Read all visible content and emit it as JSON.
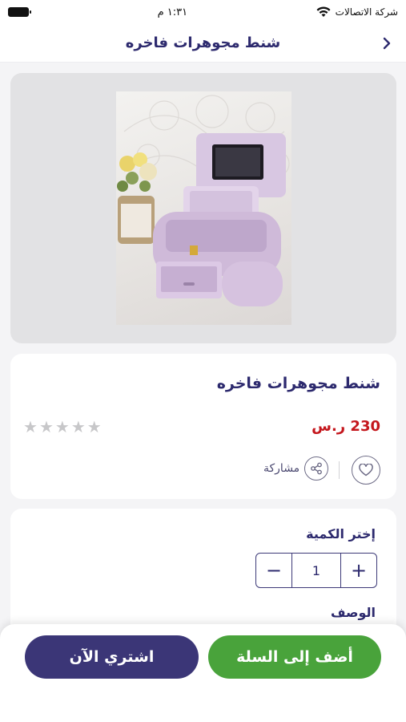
{
  "status_bar": {
    "carrier": "شركة الاتصالات",
    "time": "١:٣١ م"
  },
  "nav": {
    "title": "شنط مجوهرات فاخره",
    "back_icon": "chevron-right-icon"
  },
  "product": {
    "image_alt": "jewelry box photo",
    "title": "شنط مجوهرات فاخره",
    "price": "230 ر.س",
    "rating": 0,
    "rating_max": 5,
    "share_label": "مشاركة",
    "favorite_icon": "heart-icon",
    "share_icon": "share-icon"
  },
  "quantity": {
    "label": "إختر الكمية",
    "value": "1",
    "minus": "−",
    "plus": "+"
  },
  "description": {
    "label": "الوصف"
  },
  "actions": {
    "add_to_cart": "أضف إلى السلة",
    "buy_now": "اشتري الآن"
  },
  "colors": {
    "primary": "#3b3677",
    "accent_green": "#49a33b",
    "price_red": "#c4161c"
  }
}
